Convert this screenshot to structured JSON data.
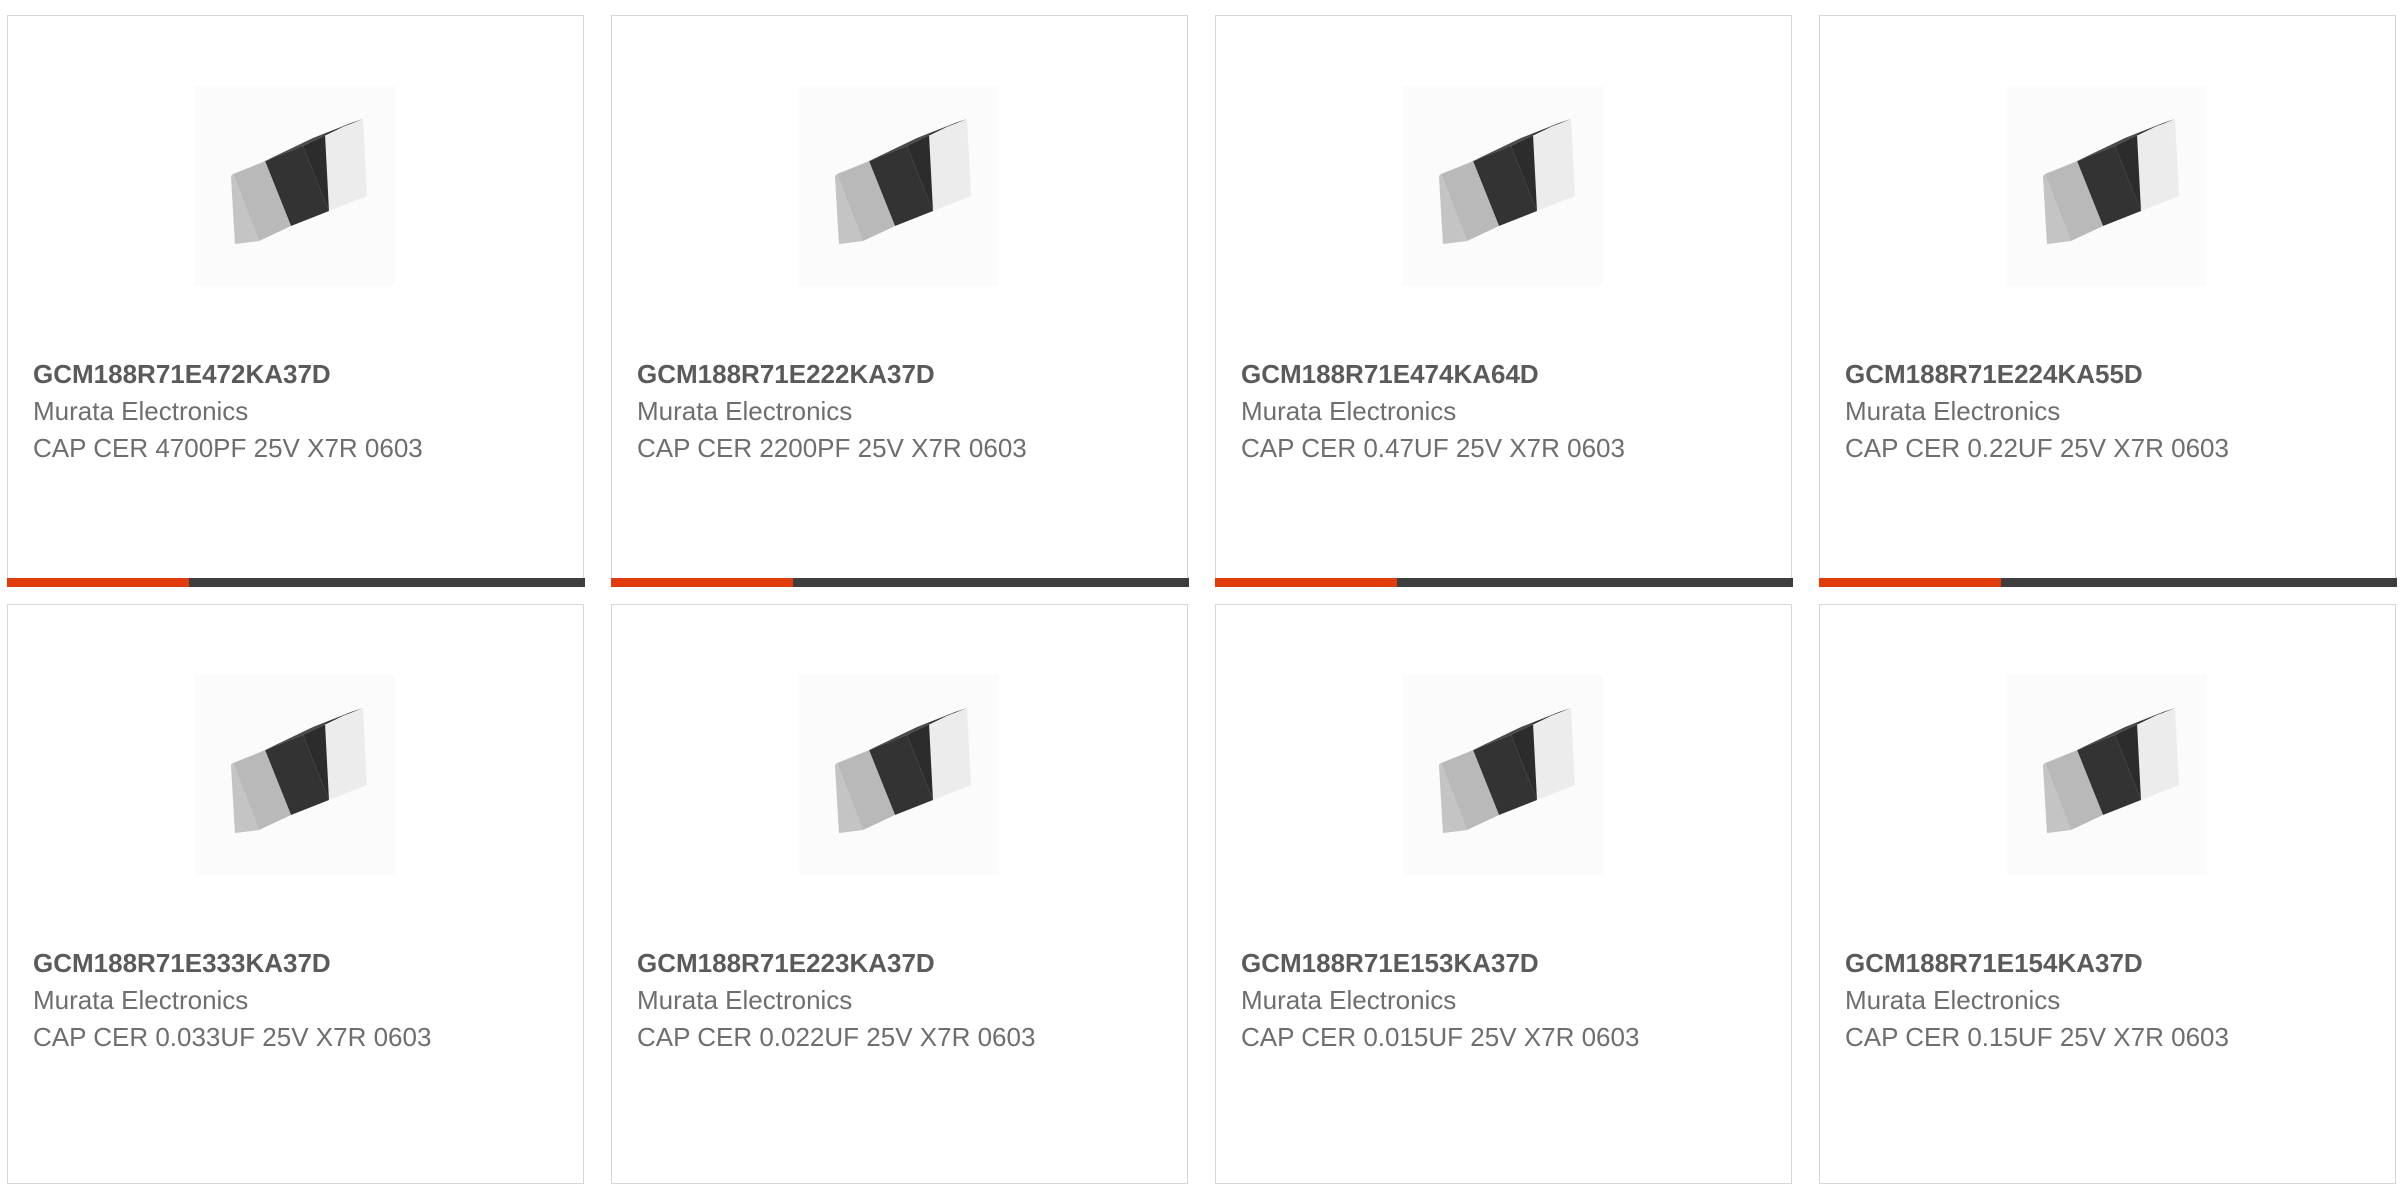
{
  "products": [
    {
      "part_number": "GCM188R71E472KA37D",
      "manufacturer": "Murata Electronics",
      "description": "CAP CER 4700PF 25V X7R 0603",
      "image_icon": "smd-capacitor-icon",
      "progress": 0.315
    },
    {
      "part_number": "GCM188R71E222KA37D",
      "manufacturer": "Murata Electronics",
      "description": "CAP CER 2200PF 25V X7R 0603",
      "image_icon": "smd-capacitor-icon",
      "progress": 0.315
    },
    {
      "part_number": "GCM188R71E474KA64D",
      "manufacturer": "Murata Electronics",
      "description": "CAP CER 0.47UF 25V X7R 0603",
      "image_icon": "smd-capacitor-icon",
      "progress": 0.315
    },
    {
      "part_number": "GCM188R71E224KA55D",
      "manufacturer": "Murata Electronics",
      "description": "CAP CER 0.22UF 25V X7R 0603",
      "image_icon": "smd-capacitor-icon",
      "progress": 0.315
    },
    {
      "part_number": "GCM188R71E333KA37D",
      "manufacturer": "Murata Electronics",
      "description": "CAP CER 0.033UF 25V X7R 0603",
      "image_icon": "smd-capacitor-icon"
    },
    {
      "part_number": "GCM188R71E223KA37D",
      "manufacturer": "Murata Electronics",
      "description": "CAP CER 0.022UF 25V X7R 0603",
      "image_icon": "smd-capacitor-icon"
    },
    {
      "part_number": "GCM188R71E153KA37D",
      "manufacturer": "Murata Electronics",
      "description": "CAP CER 0.015UF 25V X7R 0603",
      "image_icon": "smd-capacitor-icon"
    },
    {
      "part_number": "GCM188R71E154KA37D",
      "manufacturer": "Murata Electronics",
      "description": "CAP CER 0.15UF 25V X7R 0603",
      "image_icon": "smd-capacitor-icon"
    }
  ],
  "colors": {
    "accent": "#e23b0e",
    "progress_track": "#3e3e3e",
    "card_border": "#d6d6d6",
    "text_primary": "#5a5a5a",
    "text_secondary": "#6e6e6e"
  }
}
